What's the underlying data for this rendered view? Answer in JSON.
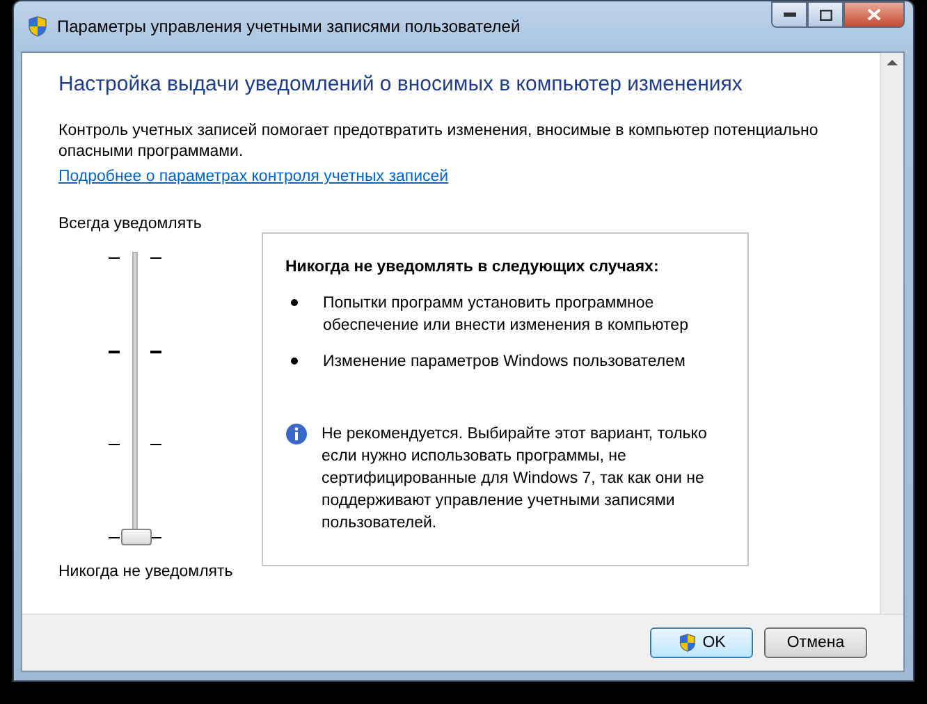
{
  "window": {
    "title": "Параметры управления учетными записями пользователей"
  },
  "heading": "Настройка выдачи уведомлений о вносимых в компьютер изменениях",
  "intro": "Контроль учетных записей помогает предотвратить изменения, вносимые в компьютер потенциально опасными программами.",
  "link": "Подробнее о параметрах контроля учетных записей",
  "slider": {
    "top_label": "Всегда уведомлять",
    "bottom_label": "Никогда не уведомлять",
    "level": 0
  },
  "info_panel": {
    "title": "Никогда не уведомлять в следующих случаях:",
    "bullets": [
      "Попытки программ установить программное обеспечение или внести изменения в компьютер",
      "Изменение параметров Windows пользователем"
    ],
    "note": "Не рекомендуется. Выбирайте этот вариант, только если нужно использовать программы, не сертифицированные для Windows 7, так как они не поддерживают управление учетными записями пользователей."
  },
  "buttons": [
    {
      "label": "OK",
      "kind": "shield"
    },
    {
      "label": "Отмена",
      "kind": "plain"
    }
  ]
}
